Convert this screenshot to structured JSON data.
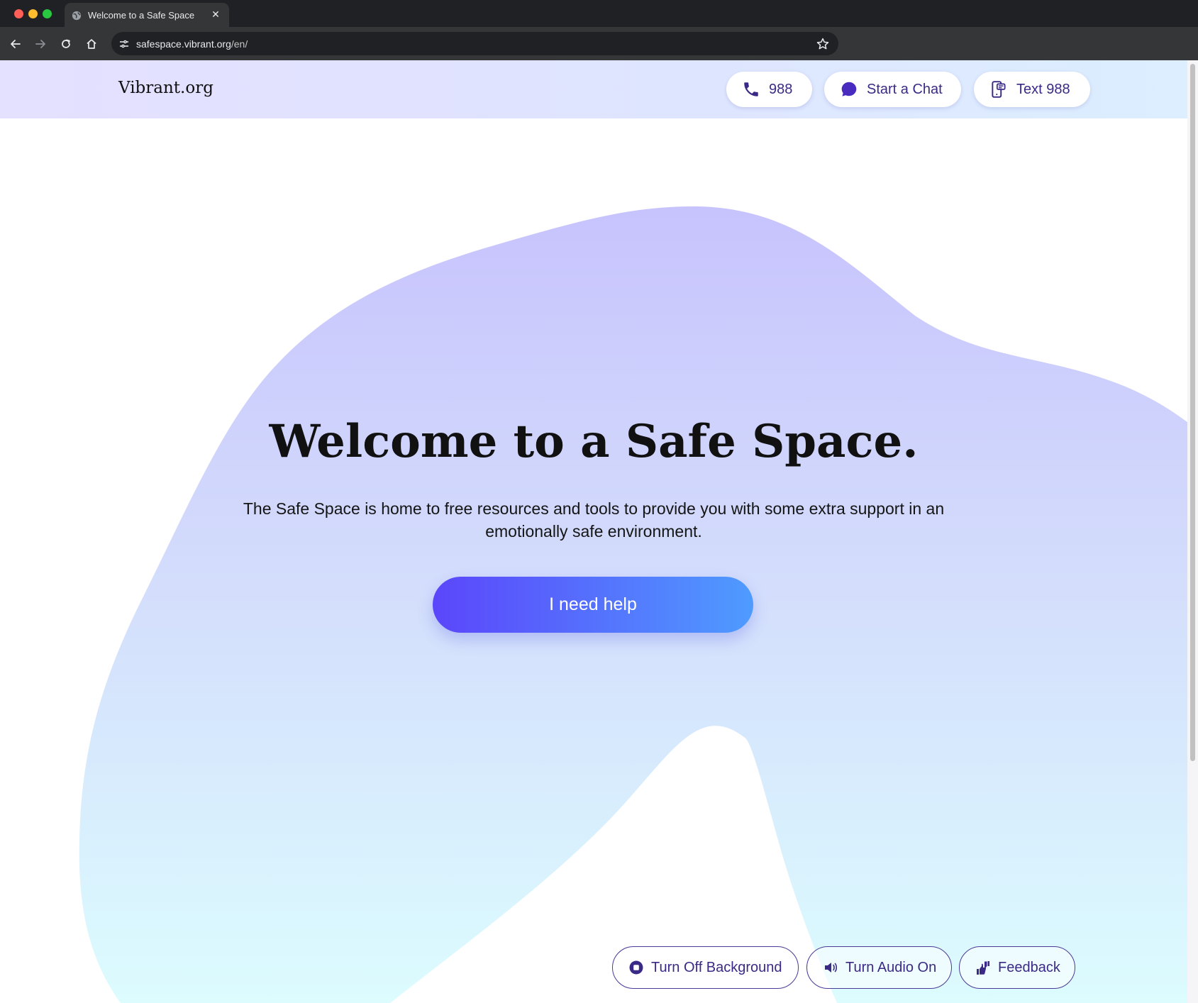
{
  "browser": {
    "tab_title": "Welcome to a Safe Space",
    "url_domain": "safespace.vibrant.org",
    "url_path": "/en/"
  },
  "header": {
    "logo": "Vibrant.org",
    "call_label": "988",
    "chat_label": "Start a Chat",
    "text_label": "Text 988"
  },
  "hero": {
    "title": "Welcome to a Safe Space.",
    "subtitle": "The Safe Space is home to free resources and tools to provide you with some extra support in an emotionally safe environment.",
    "cta_label": "I need help"
  },
  "footer_controls": {
    "background_label": "Turn Off Background",
    "audio_label": "Turn Audio On",
    "feedback_label": "Feedback"
  },
  "colors": {
    "accent_dark": "#3b2a85",
    "cta_start": "#5b46fb",
    "cta_end": "#4f9bff",
    "blob_top": "#c7c3fd",
    "blob_bottom": "#dcfcfe"
  },
  "icons": {
    "call": "phone-icon",
    "chat": "chat-bubble-icon",
    "text": "mobile-message-icon",
    "background": "stop-icon",
    "audio": "speaker-icon",
    "feedback": "thumbs-up-down-icon"
  }
}
